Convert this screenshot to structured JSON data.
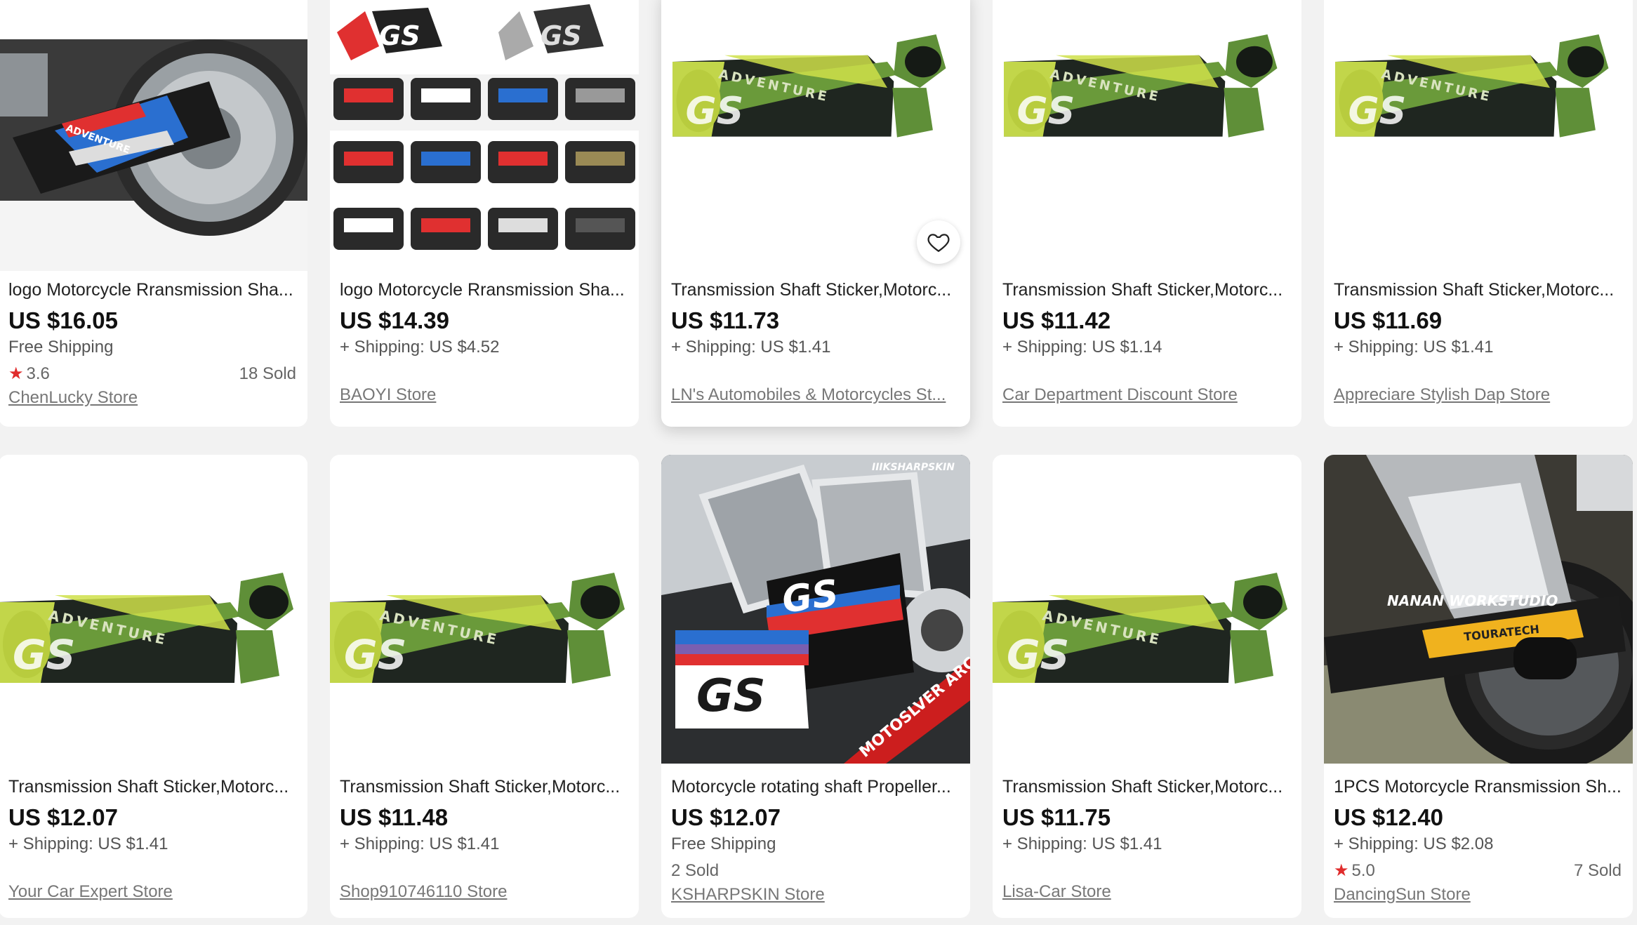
{
  "products": [
    {
      "title": "logo Motorcycle Rransmission Sha...",
      "price": "US $16.05",
      "shipping": "Free Shipping",
      "rating": "3.6",
      "sold": "18 Sold",
      "store": "ChenLucky Store",
      "image": "motorcycle-rear-wheel-photo"
    },
    {
      "title": "logo Motorcycle Rransmission Sha...",
      "price": "US $14.39",
      "shipping": "+ Shipping: US $4.52",
      "rating": "",
      "sold": "",
      "store": "BAOYI Store",
      "image": "sticker-variants-grid"
    },
    {
      "title": "Transmission Shaft Sticker,Motorc...",
      "price": "US $11.73",
      "shipping": "+ Shipping: US $1.41",
      "rating": "",
      "sold": "",
      "store": "LN's Automobiles & Motorcycles St...",
      "image": "adventure-green-sticker",
      "wishlist_icon": "heart-icon"
    },
    {
      "title": "Transmission Shaft Sticker,Motorc...",
      "price": "US $11.42",
      "shipping": "+ Shipping: US $1.14",
      "rating": "",
      "sold": "",
      "store": "Car Department Discount Store",
      "image": "adventure-green-sticker"
    },
    {
      "title": "Transmission Shaft Sticker,Motorc...",
      "price": "US $11.69",
      "shipping": "+ Shipping: US $1.41",
      "rating": "",
      "sold": "",
      "store": "Appreciare Stylish Dap Store",
      "image": "adventure-green-sticker"
    },
    {
      "title": "Transmission Shaft Sticker,Motorc...",
      "price": "US $12.07",
      "shipping": "+ Shipping: US $1.41",
      "rating": "",
      "sold": "",
      "store": "Your Car Expert Store",
      "image": "adventure-green-sticker"
    },
    {
      "title": "Transmission Shaft Sticker,Motorc...",
      "price": "US $11.48",
      "shipping": "+ Shipping: US $1.41",
      "rating": "",
      "sold": "",
      "store": "Shop910746110 Store",
      "image": "adventure-green-sticker"
    },
    {
      "title": "Motorcycle rotating shaft Propeller...",
      "price": "US $12.07",
      "shipping": "Free Shipping",
      "rating": "",
      "sold": "2 Sold",
      "store": "KSHARPSKIN Store",
      "image": "gs-sticker-motorcycle-photo",
      "watermark": "IIIKSHARPSKIN",
      "banner": "MOTOSLVER ARC"
    },
    {
      "title": "Transmission Shaft Sticker,Motorc...",
      "price": "US $11.75",
      "shipping": "+ Shipping: US $1.41",
      "rating": "",
      "sold": "",
      "store": "Lisa-Car Store",
      "image": "adventure-green-sticker"
    },
    {
      "title": "1PCS Motorcycle Rransmission Sh...",
      "price": "US $12.40",
      "shipping": "+ Shipping: US $2.08",
      "rating": "5.0",
      "sold": "7 Sold",
      "store": "DancingSun Store",
      "image": "touratech-motorcycle-photo"
    }
  ],
  "colors": {
    "star": "#e02c2c",
    "price": "#111111",
    "background": "#f2f2f2",
    "card": "#ffffff"
  }
}
